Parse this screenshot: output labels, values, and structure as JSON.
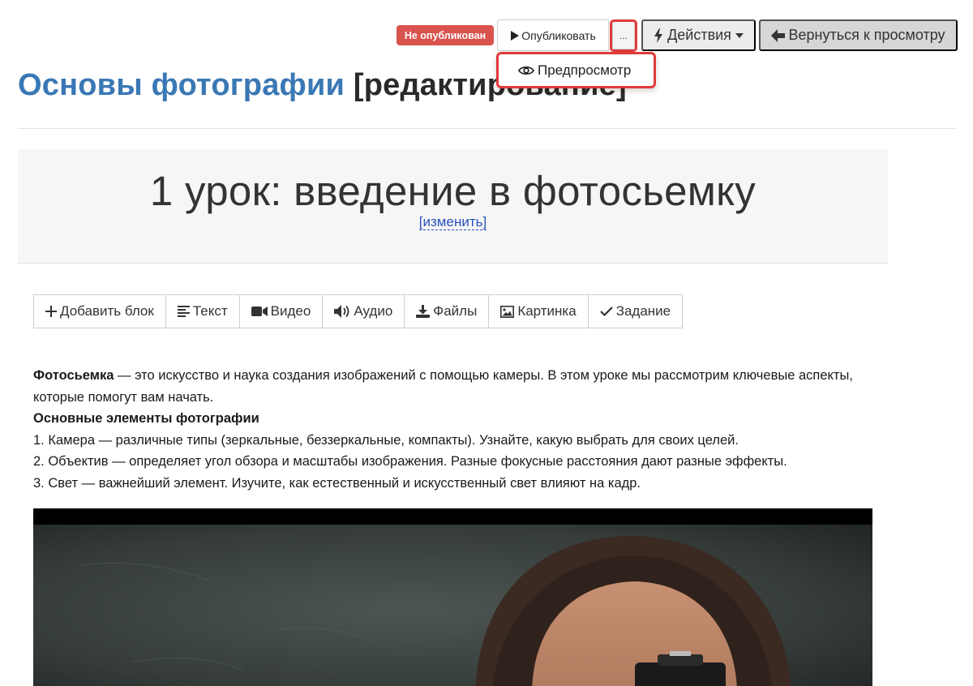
{
  "toolbar": {
    "status_badge": "Не опубликован",
    "publish_label": "Опубликовать",
    "more_label": "...",
    "actions_label": "Действия",
    "back_label": "Вернуться к просмотру"
  },
  "dropdown": {
    "preview_label": "Предпросмотр"
  },
  "page": {
    "course_name": "Основы фотографии",
    "edit_suffix": "[редактирование]"
  },
  "lesson": {
    "title": "1 урок: введение в фотосьемку",
    "edit_link": "[изменить]"
  },
  "blocks": {
    "add_block": "Добавить блок",
    "text": "Текст",
    "video": "Видео",
    "audio": "Аудио",
    "files": "Файлы",
    "image": "Картинка",
    "task": "Задание"
  },
  "content": {
    "intro_term": "Фотосьемка",
    "intro_text": " — это искусство и наука создания изображений с помощью камеры. В этом уроке мы рассмотрим ключевые аспекты, которые помогут вам начать.",
    "section_heading": "Основные элементы фотографии",
    "items": [
      "1. Камера — различные типы (зеркальные, беззеркальные, компакты). Узнайте, какую выбрать для своих целей.",
      "2. Объектив — определяет угол обзора и масштабы изображения. Разные фокусные расстояния дают разные эффекты.",
      "3. Свет — важнейший элемент. Изучите, как естественный и искусственный свет влияют на кадр."
    ]
  },
  "colors": {
    "accent_blue": "#3a78b5",
    "badge_red": "#d9534f",
    "highlight_red": "#e03a3a",
    "link_blue": "#2a52be"
  }
}
